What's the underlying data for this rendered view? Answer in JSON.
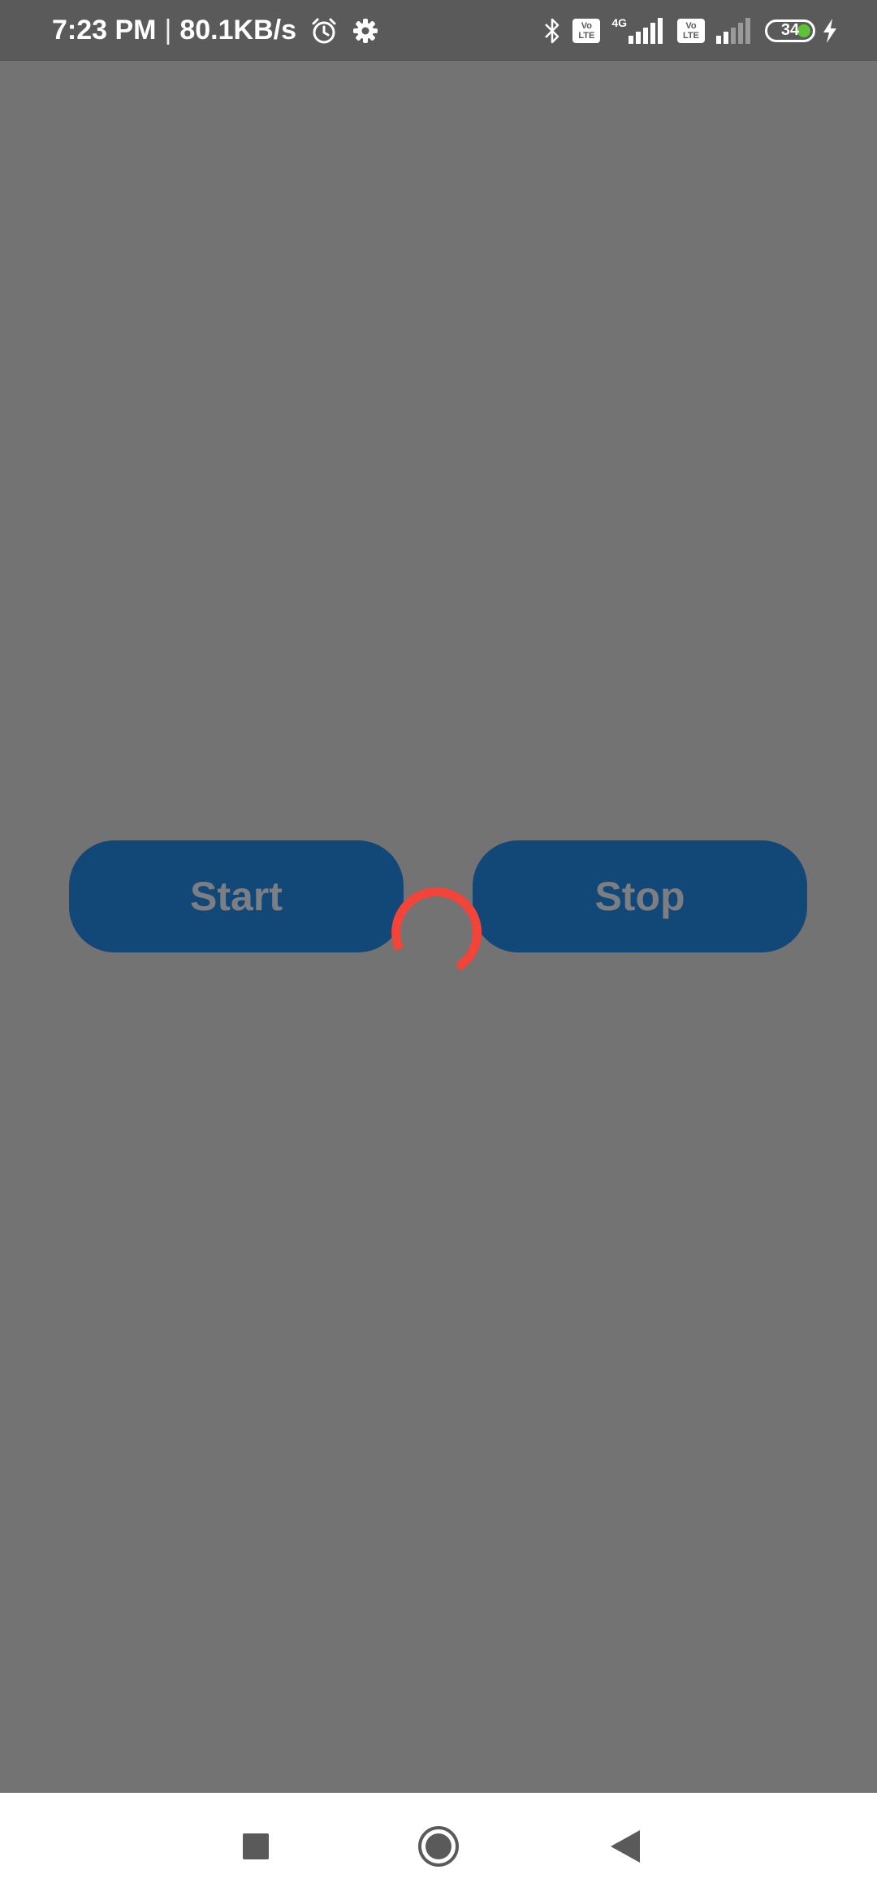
{
  "status_bar": {
    "time": "7:23 PM",
    "separator": "|",
    "net_speed": "80.1KB/s",
    "volte_1": "Vo LTE",
    "network_type": "4G",
    "volte_2": "Vo LTE",
    "battery_level": "34"
  },
  "controls": {
    "start_label": "Start",
    "stop_label": "Stop"
  },
  "colors": {
    "background": "#737373",
    "status_bar": "#5a5a5a",
    "button_fill": "#124877",
    "button_text": "#7b7f84",
    "spinner": "#f24438",
    "battery_fill": "#5ec236"
  },
  "icons": {
    "alarm": "alarm-icon",
    "settings": "gear-icon",
    "bluetooth": "bluetooth-icon",
    "signal_1": "signal-icon",
    "signal_2": "signal-icon",
    "charging": "bolt-icon",
    "spinner": "loading-spinner",
    "recents": "square-icon",
    "home": "circle-icon",
    "back": "triangle-icon"
  }
}
